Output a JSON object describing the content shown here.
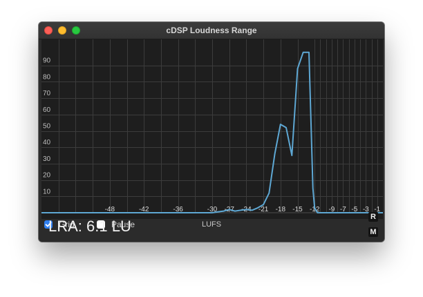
{
  "window": {
    "title": "cDSP Loudness Range"
  },
  "controls": {
    "grid_label": "Grid",
    "grid_checked": true,
    "pause_label": "Pause",
    "pause_checked": false,
    "unit_label": "LUFS"
  },
  "readout": {
    "lra": "LRA: 6.1 LU"
  },
  "buttons": {
    "r_label": "R",
    "m_label": "M"
  },
  "chart_data": {
    "type": "line",
    "xlabel": "LUFS",
    "ylabel": "",
    "xlim": [
      -60,
      0
    ],
    "ylim": [
      0,
      100
    ],
    "x_ticks": [
      -48,
      -42,
      -36,
      -30,
      -27,
      -24,
      -21,
      -18,
      -15,
      -12,
      -9,
      -7,
      -5,
      -3,
      -1
    ],
    "y_ticks": [
      10,
      20,
      30,
      40,
      50,
      60,
      70,
      80,
      90
    ],
    "grid": true,
    "line_color": "#5ea8d4",
    "series": [
      {
        "x": [
          -60,
          -31,
          -30,
          -29,
          -28,
          -27,
          -26,
          -25,
          -24,
          -23,
          -22,
          -21,
          -20,
          -19,
          -18,
          -17,
          -16,
          -15,
          -14,
          -13,
          -12.3,
          -12,
          -11.5,
          0
        ],
        "y": [
          0,
          0,
          0,
          0.5,
          1,
          2,
          1,
          1.5,
          2,
          1.5,
          3,
          5,
          12,
          36,
          54,
          52,
          35,
          88,
          98,
          98,
          15,
          3,
          0,
          0
        ]
      }
    ]
  }
}
